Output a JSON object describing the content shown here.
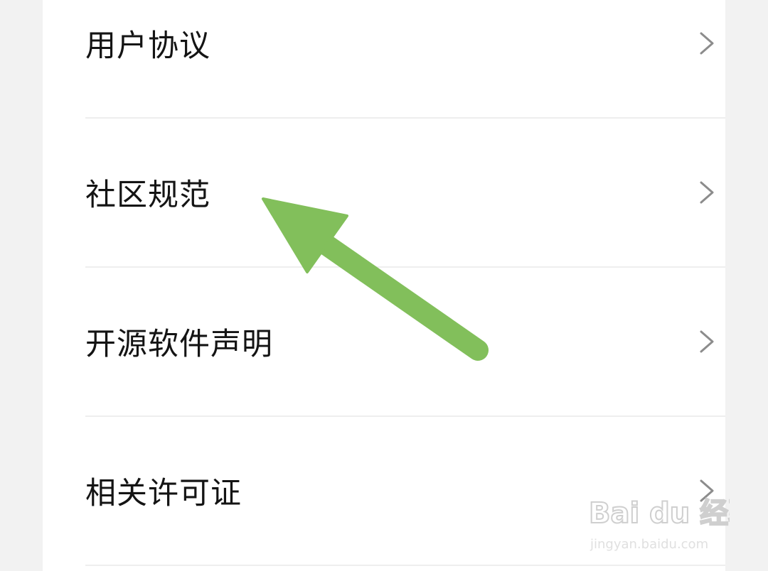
{
  "settings_list": {
    "items": [
      {
        "label": "用户协议"
      },
      {
        "label": "社区规范"
      },
      {
        "label": "开源软件声明"
      },
      {
        "label": "相关许可证"
      }
    ]
  },
  "annotation": {
    "arrow_color": "#82bf5b",
    "icon": "arrow-pointing-up-left"
  },
  "watermark": {
    "brand": "Bai du 经验",
    "url": "jingyan.baidu.com"
  },
  "colors": {
    "background": "#f2f2f2",
    "card": "#ffffff",
    "text": "#141414",
    "divider": "#eeeeee",
    "chevron": "#8c8c8c"
  }
}
